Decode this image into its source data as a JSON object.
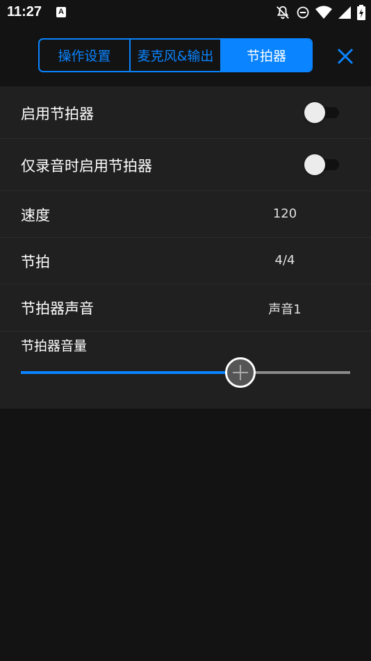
{
  "status_bar": {
    "time": "11:27",
    "a_badge": "A"
  },
  "tabs": [
    {
      "label": "操作设置",
      "active": false
    },
    {
      "label": "麦克风&输出",
      "active": false
    },
    {
      "label": "节拍器",
      "active": true
    }
  ],
  "settings": {
    "enable_metronome": {
      "label": "启用节拍器",
      "on": false
    },
    "record_only": {
      "label": "仅录音时启用节拍器",
      "on": false
    },
    "speed": {
      "label": "速度",
      "value": "120"
    },
    "beat": {
      "label": "节拍",
      "value": "4/4"
    },
    "sound": {
      "label": "节拍器声音",
      "value": "声音1"
    },
    "volume": {
      "label": "节拍器音量",
      "level": 0.667
    }
  },
  "colors": {
    "accent": "#0a84ff",
    "background": "#131313",
    "panel": "#202020"
  }
}
